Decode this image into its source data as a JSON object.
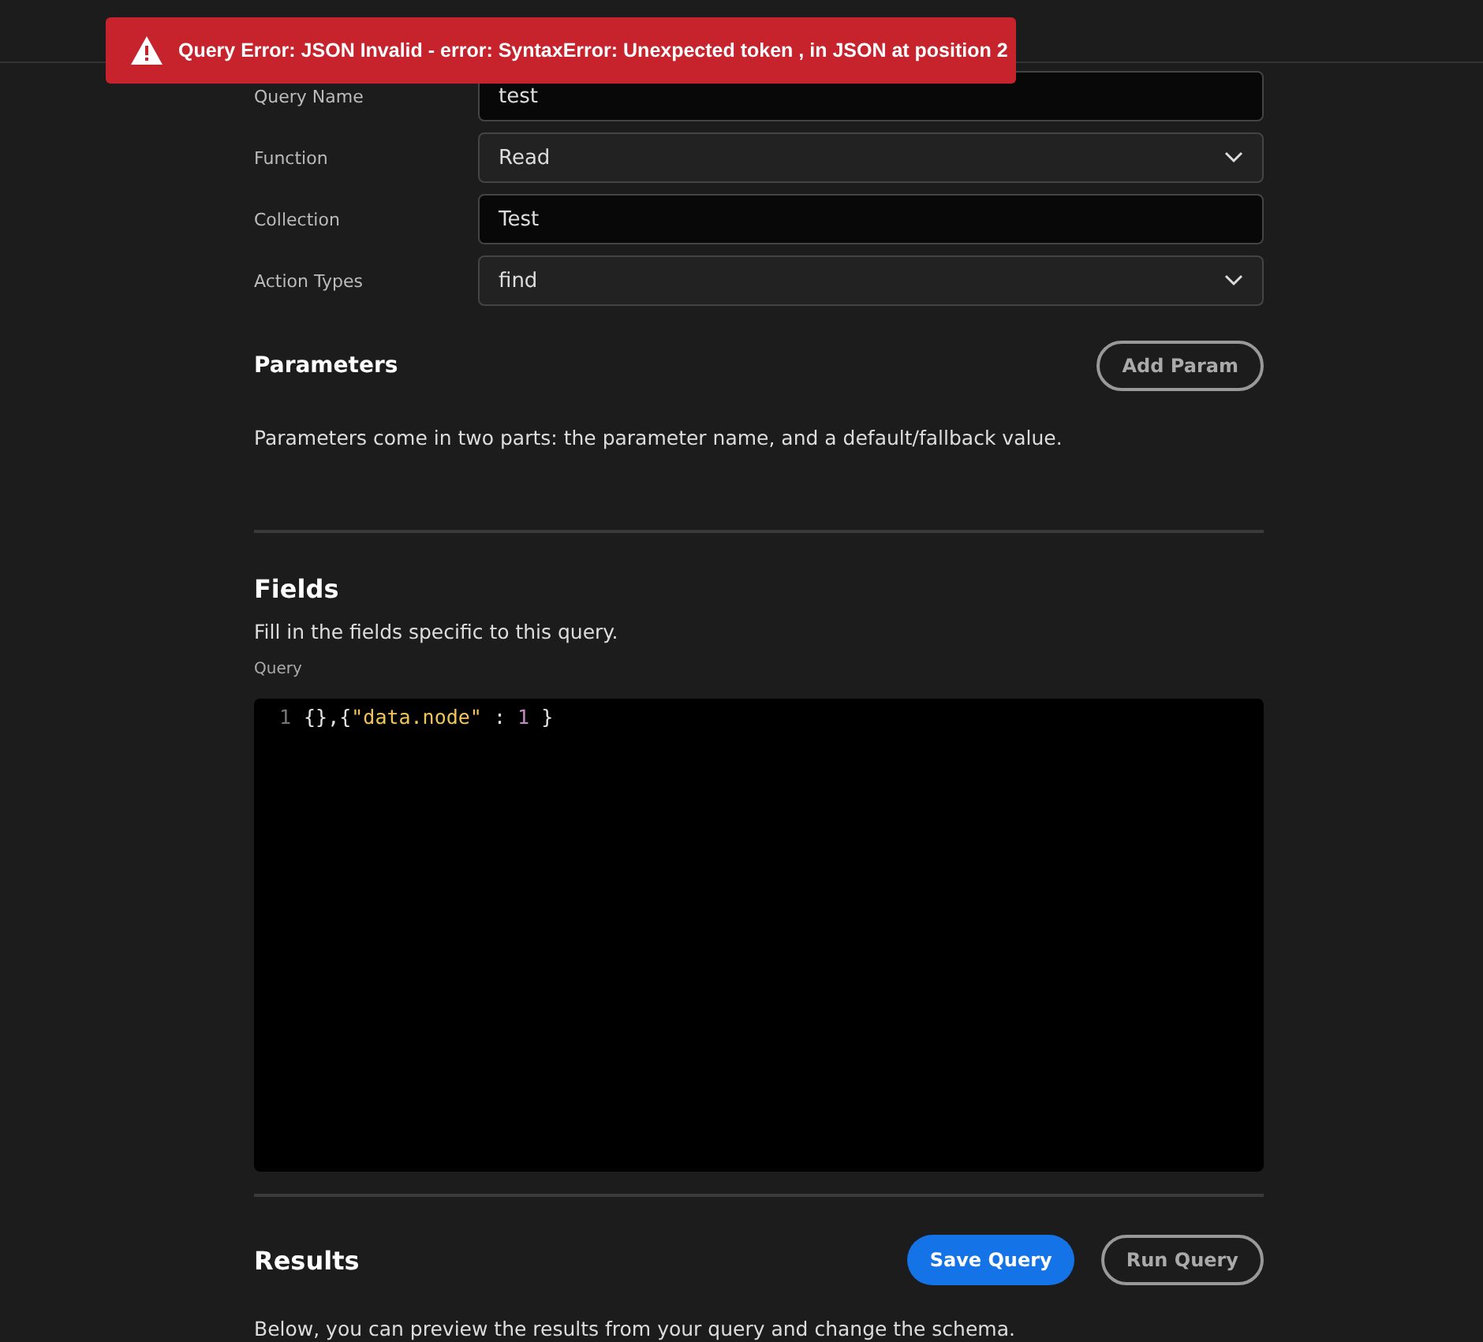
{
  "toast": {
    "kind": "error",
    "message": "Query Error: JSON Invalid - error: SyntaxError: Unexpected token , in JSON at position 2"
  },
  "form": [
    {
      "label": "Query Name",
      "kind": "text",
      "value": "test"
    },
    {
      "label": "Function",
      "kind": "select",
      "value": "Read"
    },
    {
      "label": "Collection",
      "kind": "text",
      "value": "Test"
    },
    {
      "label": "Action Types",
      "kind": "select",
      "value": "find"
    }
  ],
  "parameters": {
    "title": "Parameters",
    "button": "Add Param",
    "description": "Parameters come in two parts: the parameter name, and a default/fallback value."
  },
  "fields": {
    "title": "Fields",
    "description": "Fill in the fields specific to this query.",
    "editor_label": "Query",
    "code_lines": [
      {
        "number": "1",
        "tokens": [
          {
            "kind": "punct",
            "text": "{},{"
          },
          {
            "kind": "string",
            "text": "\"data.node\""
          },
          {
            "kind": "punct",
            "text": " : "
          },
          {
            "kind": "number",
            "text": "1"
          },
          {
            "kind": "punct",
            "text": " }"
          }
        ]
      }
    ]
  },
  "results": {
    "title": "Results",
    "buttons": [
      {
        "label": "Save Query",
        "kind": "primary"
      },
      {
        "label": "Run Query",
        "kind": "secondary"
      }
    ],
    "description": "Below, you can preview the results from your query and change the schema."
  }
}
